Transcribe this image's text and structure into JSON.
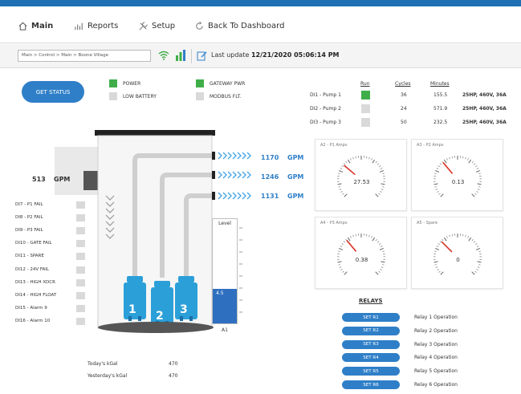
{
  "nav": {
    "main": "Main",
    "reports": "Reports",
    "setup": "Setup",
    "back": "Back To Dashboard"
  },
  "toolbar": {
    "breadcrumb": "Main > Control > Main > Boone Village",
    "last_update_label": "Last update",
    "last_update_value": "12/21/2020 05:06:14 PM"
  },
  "status_button": "GET STATUS",
  "indicators": {
    "power": "POWER",
    "low_battery": "LOW BATTERY",
    "gateway_pwr": "GATEWAY PWR",
    "modbus_flt": "MODBUS FLT."
  },
  "pumps_table": {
    "headers": {
      "run": "Run",
      "cycles": "Cycles",
      "minutes": "Minutes"
    },
    "rows": [
      {
        "name": "DI1 - Pump 1",
        "cycles": "36",
        "minutes": "155.5",
        "spec": "25HP, 460V, 36A",
        "running": true
      },
      {
        "name": "DI2 - Pump 2",
        "cycles": "24",
        "minutes": "571.9",
        "spec": "25HP, 460V, 36A",
        "running": false
      },
      {
        "name": "DI3 - Pump 3",
        "cycles": "50",
        "minutes": "232.5",
        "spec": "25HP, 460V, 36A",
        "running": false
      }
    ]
  },
  "inflow": {
    "value": "513",
    "unit": "GPM"
  },
  "outflows": [
    {
      "value": "1170",
      "unit": "GPM"
    },
    {
      "value": "1246",
      "unit": "GPM"
    },
    {
      "value": "1131",
      "unit": "GPM"
    }
  ],
  "pump_labels": [
    "1",
    "2",
    "3"
  ],
  "level": {
    "title": "Level",
    "value": "4.5",
    "sensor": "A1",
    "fraction": 0.33
  },
  "alarms": [
    "DI7 - P1 FAIL",
    "DI8 - P2 FAIL",
    "DI9 - P3 FAIL",
    "DI10 - GATE FAIL",
    "DI11 - SPARE",
    "DI12 - 24V FAIL",
    "DI13 - HIGH XDCR",
    "DI14 - HIGH FLOAT",
    "DI15 - Alarm 9",
    "DI16 - Alarm 10"
  ],
  "gauges": [
    {
      "title": "A2 - P1 Amps",
      "value": "27.53"
    },
    {
      "title": "A3 - P2 Amps",
      "value": "0.13"
    },
    {
      "title": "A4 - P3 Amps",
      "value": "0.38"
    },
    {
      "title": "A5 - Spare",
      "value": "0"
    }
  ],
  "relays": {
    "title": "RELAYS",
    "buttons": [
      "SET R1",
      "SET R2",
      "SET R3",
      "SET R4",
      "SET R5",
      "SET R6"
    ],
    "labels": [
      "Relay 1 Operation",
      "Relay 2 Operation",
      "Relay 3 Operation",
      "Relay 4 Operation",
      "Relay 5 Operation",
      "Relay 6 Operation"
    ]
  },
  "totals": {
    "today_label": "Today's kGal",
    "today_value": "470",
    "yesterday_label": "Yesterday's kGal",
    "yesterday_value": "470"
  },
  "colors": {
    "accent": "#2f7fc8",
    "on": "#3fae49",
    "off": "#d9d9d9",
    "pump": "#2b9fd8"
  }
}
